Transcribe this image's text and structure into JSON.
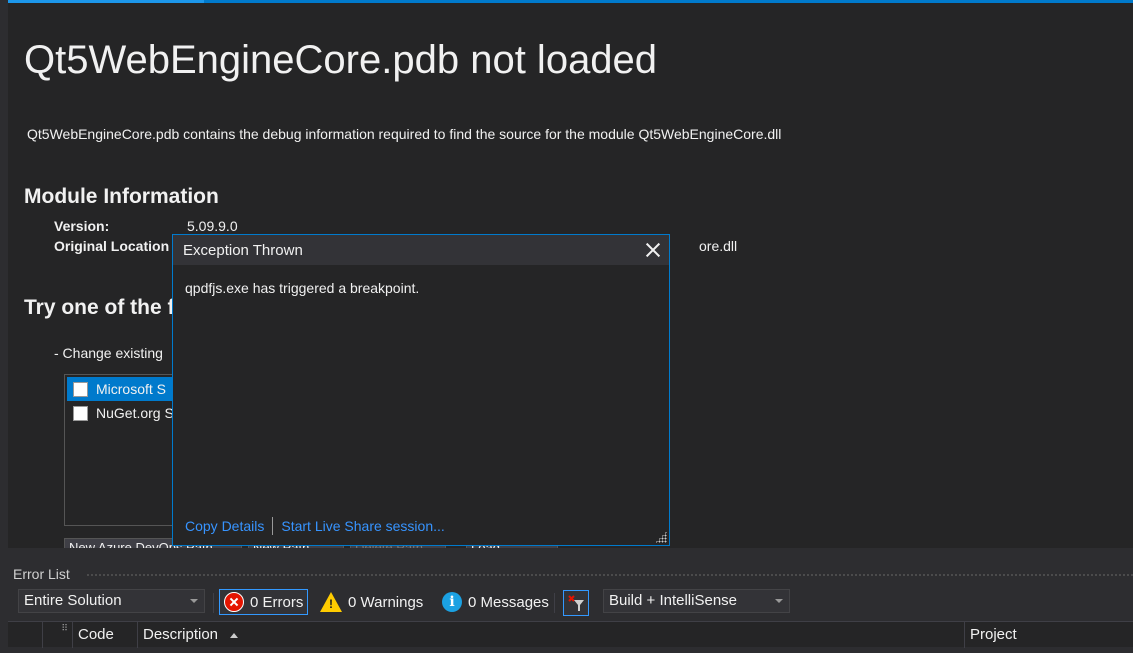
{
  "document": {
    "title": "Qt5WebEngineCore.pdb not loaded",
    "description": "Qt5WebEngineCore.pdb contains the debug information required to find the source for the module Qt5WebEngineCore.dll",
    "module_info_heading": "Module Information",
    "version_label": "Version:",
    "version_value": "5.09.9.0",
    "original_location_label": "Original Location",
    "original_location_value_tail": "ore.dll",
    "try_heading": "Try one of the fo",
    "change_option": "-  Change existing",
    "symbol_servers": [
      {
        "label": "Microsoft S",
        "checked": false,
        "selected": true
      },
      {
        "label": "NuGet.org S",
        "checked": false,
        "selected": false
      }
    ],
    "path_buttons": [
      {
        "label": "New Azure DevOps Path",
        "disabled": false
      },
      {
        "label": "New Path",
        "disabled": false
      },
      {
        "label": "Delete Path",
        "disabled": true
      },
      {
        "label": "Load",
        "disabled": false
      }
    ]
  },
  "exception_dialog": {
    "title": "Exception Thrown",
    "message": "qpdfjs.exe has triggered a breakpoint.",
    "links": [
      "Copy Details",
      "Start Live Share session..."
    ]
  },
  "error_list": {
    "title": "Error List",
    "scope_dropdown": "Entire Solution",
    "errors_label": "0 Errors",
    "warnings_label": "0 Warnings",
    "messages_label": "0 Messages",
    "build_dropdown": "Build + IntelliSense",
    "columns": {
      "code": "Code",
      "description": "Description",
      "project": "Project"
    }
  },
  "colors": {
    "accent": "#007acc",
    "background": "#252526",
    "chrome": "#2d2d30",
    "link": "#3794ff",
    "error": "#e51400",
    "warning": "#ffcc00",
    "info": "#1ba1e2"
  }
}
